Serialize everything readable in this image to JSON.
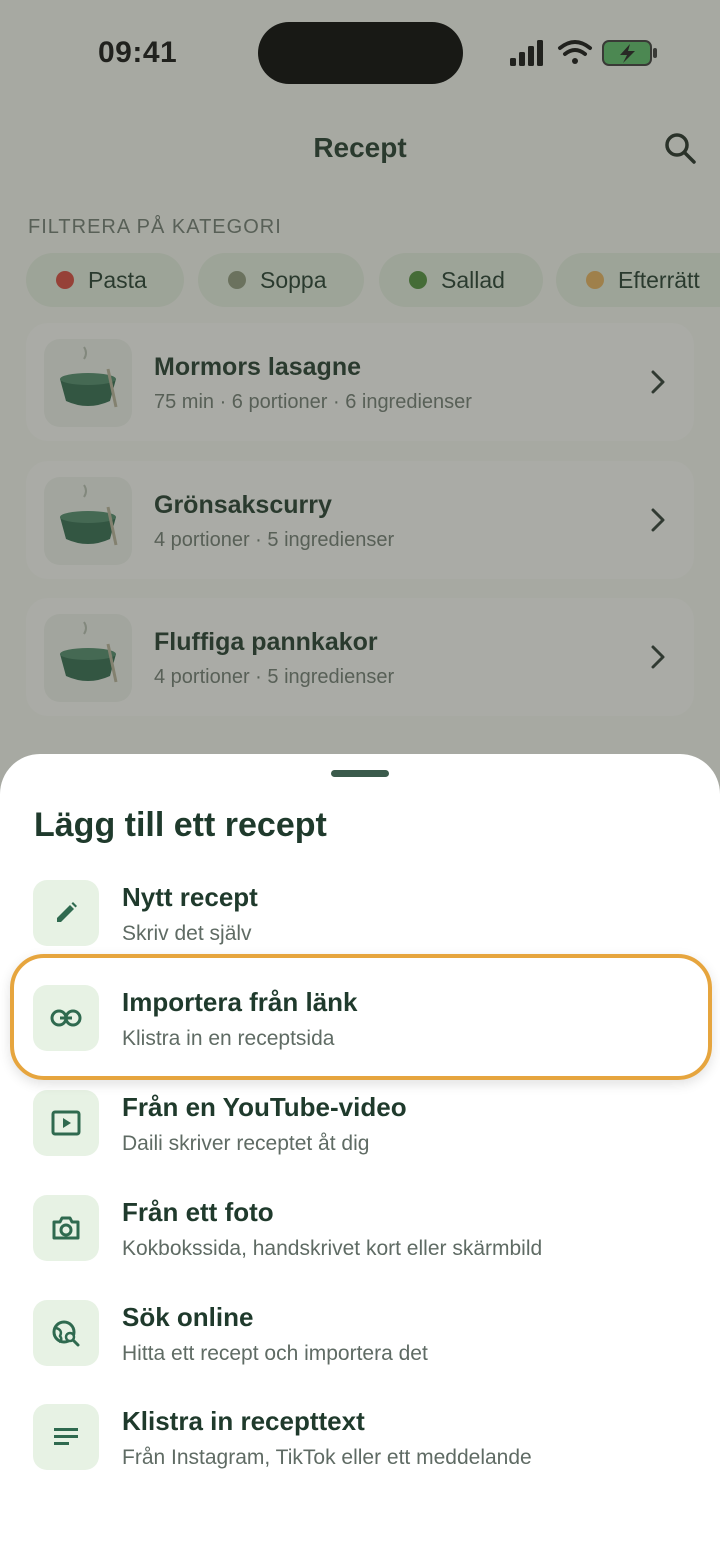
{
  "status_bar": {
    "time": "09:41"
  },
  "header": {
    "title": "Recept"
  },
  "filter": {
    "label": "FILTRERA PÅ KATEGORI",
    "chips": [
      {
        "label": "Pasta",
        "icon": "tomato-icon"
      },
      {
        "label": "Soppa",
        "icon": "soup-bowl-icon"
      },
      {
        "label": "Sallad",
        "icon": "salad-icon"
      },
      {
        "label": "Efterrätt",
        "icon": "cake-icon"
      }
    ]
  },
  "recipes": [
    {
      "title": "Mormors lasagne",
      "meta": "75 min · 6 portioner · 6 ingredienser"
    },
    {
      "title": "Grönsakscurry",
      "meta": "4 portioner · 5 ingredienser"
    },
    {
      "title": "Fluffiga pannkakor",
      "meta": "4 portioner · 5 ingredienser"
    }
  ],
  "sheet": {
    "title": "Lägg till ett recept",
    "options": [
      {
        "label": "Nytt recept",
        "sub": "Skriv det själv",
        "icon": "pencil-icon"
      },
      {
        "label": "Importera från länk",
        "sub": "Klistra in en receptsida",
        "icon": "link-icon"
      },
      {
        "label": "Från en YouTube-video",
        "sub": "Daili skriver receptet åt dig",
        "icon": "video-play-icon"
      },
      {
        "label": "Från ett foto",
        "sub": "Kokbokssida, handskrivet kort eller skärmbild",
        "icon": "camera-icon"
      },
      {
        "label": "Sök online",
        "sub": "Hitta ett recept och importera det",
        "icon": "globe-search-icon"
      },
      {
        "label": "Klistra in recepttext",
        "sub": "Från Instagram, TikTok eller ett meddelande",
        "icon": "text-lines-icon"
      }
    ]
  },
  "colors": {
    "accent": "#2f6a4f",
    "highlight": "#e6a53e",
    "chip_bg": "#e6efe2",
    "icon_bg": "#e7f2e4"
  }
}
